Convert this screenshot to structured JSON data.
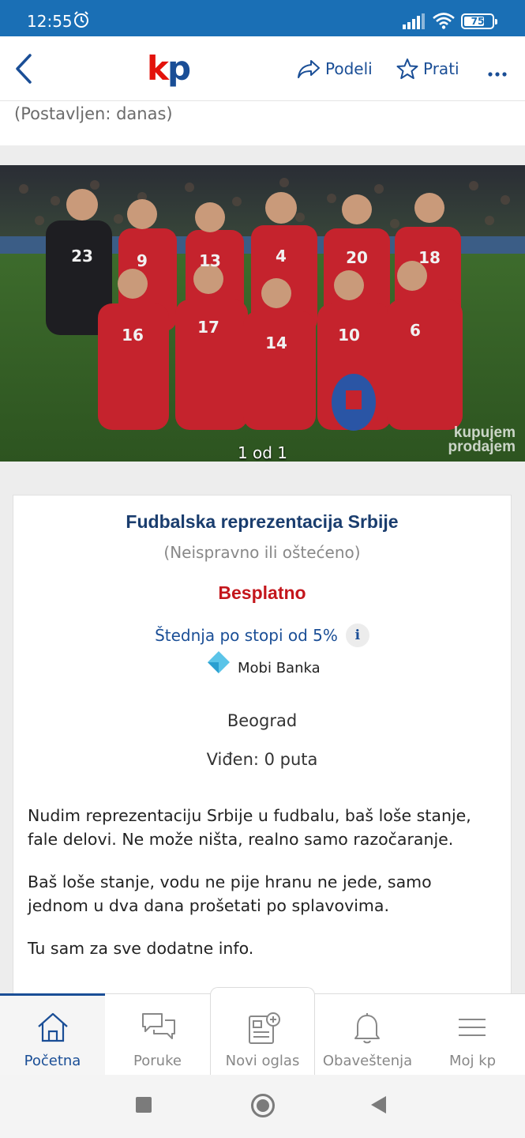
{
  "status_bar": {
    "time": "12:55",
    "battery": "75",
    "battery_level": 0.75
  },
  "header": {
    "share_label": "Podeli",
    "follow_label": "Prati",
    "logo_k": "k",
    "logo_p": "p"
  },
  "posted": "(Postavljen: danas)",
  "gallery": {
    "counter": "1 od 1",
    "watermark_line1": "kupujem",
    "watermark_line2": "prodajem",
    "jerseys": [
      "23",
      "9",
      "13",
      "4",
      "20",
      "18",
      "16",
      "17",
      "14",
      "10",
      "6"
    ]
  },
  "ad": {
    "title": "Fudbalska reprezentacija Srbije",
    "condition": "(Neispravno ili oštećeno)",
    "price": "Besplatno",
    "savings": "Štednja po stopi od 5%",
    "bank": "Mobi Banka",
    "location": "Beograd",
    "views": "Viđen: 0 puta",
    "description": [
      "Nudim reprezentaciju Srbije u fudbalu, baš loše stanje, fale delovi. Ne može ništa, realno samo razočaranje.",
      "Baš loše stanje, vodu ne pije hranu ne jede, samo jednom u dva dana prošetati po splavovima.",
      "Tu sam za sve dodatne info."
    ]
  },
  "bottom_nav": [
    {
      "label": "Početna",
      "icon": "home-icon"
    },
    {
      "label": "Poruke",
      "icon": "messages-icon"
    },
    {
      "label": "Novi oglas",
      "icon": "new-ad-icon"
    },
    {
      "label": "Obaveštenja",
      "icon": "bell-icon"
    },
    {
      "label": "Moj kp",
      "icon": "menu-icon"
    }
  ],
  "colors": {
    "brand_blue": "#1a4e96",
    "status_blue": "#1a6fb5",
    "logo_red": "#e3120b",
    "price_red": "#c4161c"
  }
}
